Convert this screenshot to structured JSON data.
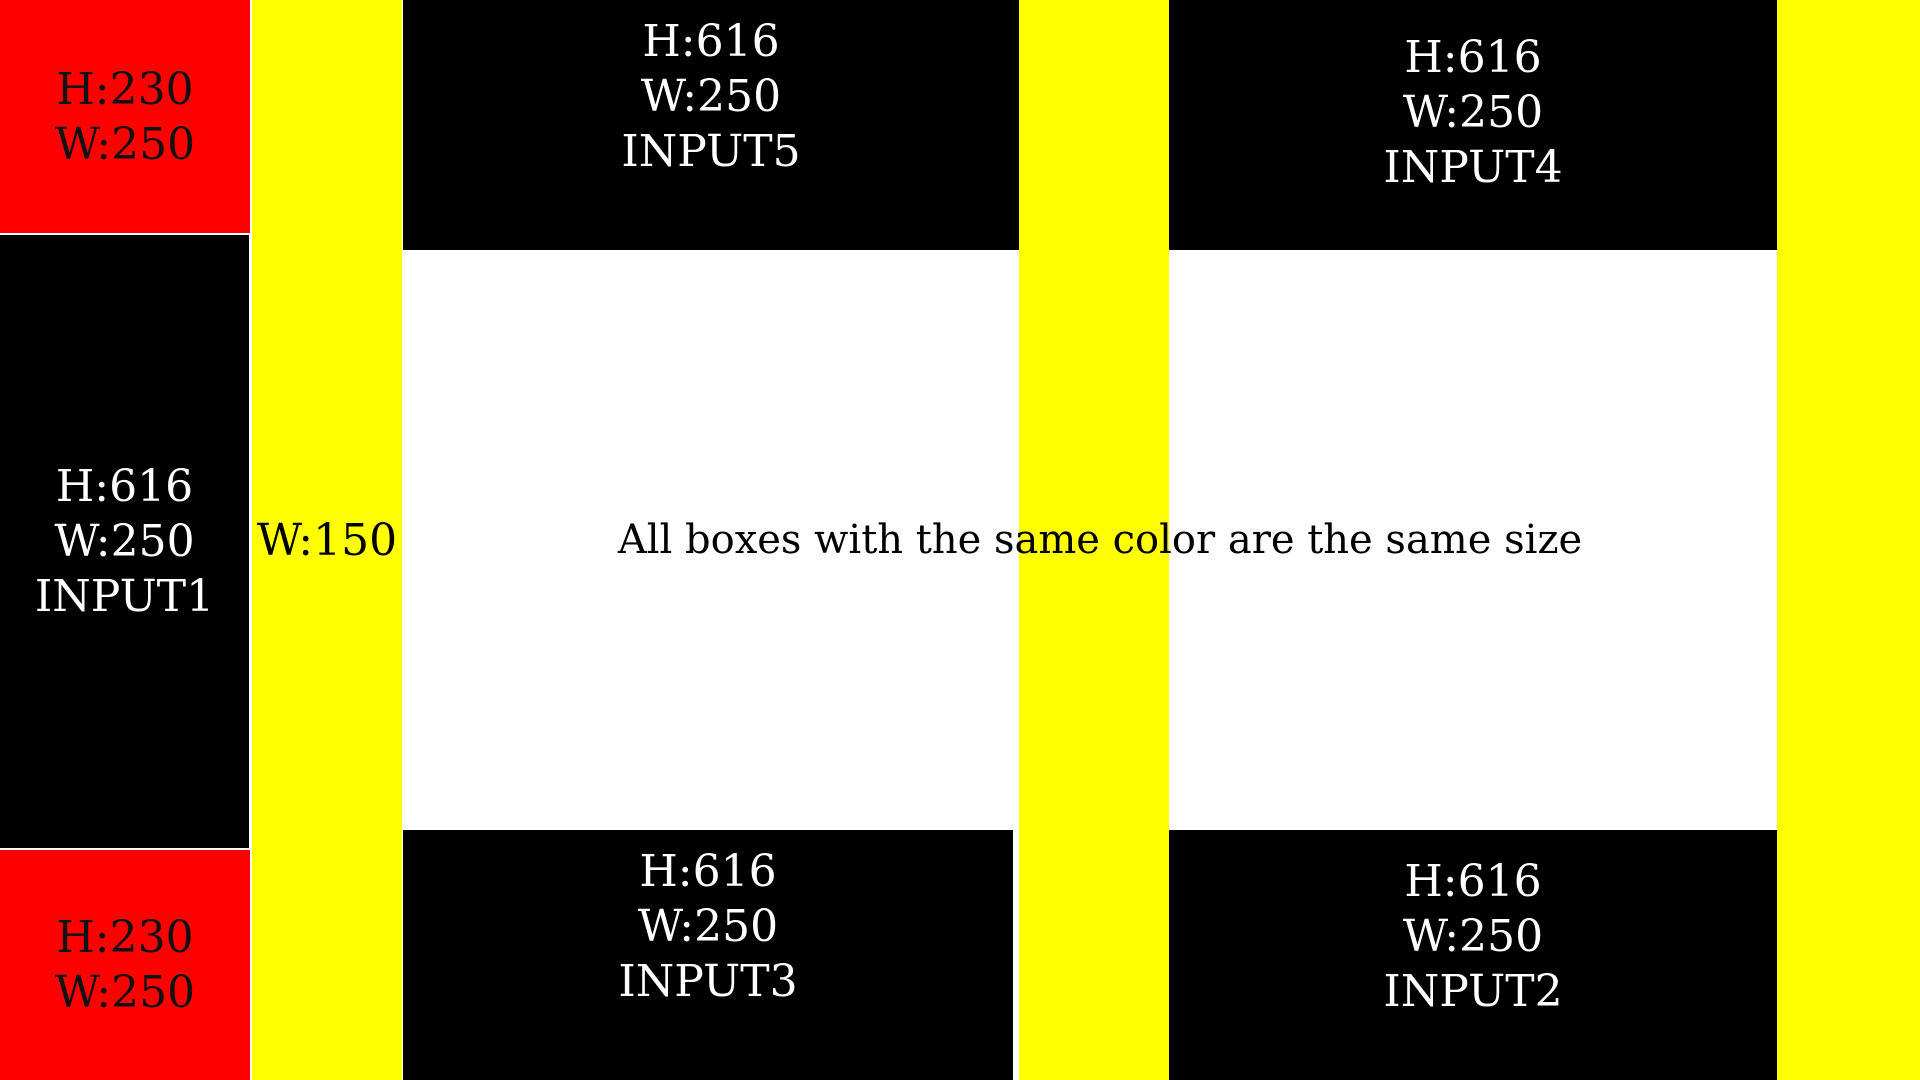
{
  "boxes": {
    "red_top": {
      "line1": "H:230",
      "line2": "W:250"
    },
    "black_left": {
      "line1": "H:616",
      "line2": "W:250",
      "line3": "INPUT1"
    },
    "red_bottom": {
      "line1": "H:230",
      "line2": "W:250"
    },
    "yellow_left": {
      "line1": "W:150"
    },
    "black_input5": {
      "line1": "H:616",
      "line2": "W:250",
      "line3": "INPUT5"
    },
    "black_input4": {
      "line1": "H:616",
      "line2": "W:250",
      "line3": "INPUT4"
    },
    "black_input3": {
      "line1": "H:616",
      "line2": "W:250",
      "line3": "INPUT3"
    },
    "black_input2": {
      "line1": "H:616",
      "line2": "W:250",
      "line3": "INPUT2"
    }
  },
  "center_note": "All boxes with the same color are the same size",
  "colors": {
    "red": "#ff0000",
    "black": "#000000",
    "yellow": "#ffff00",
    "white": "#ffffff"
  }
}
